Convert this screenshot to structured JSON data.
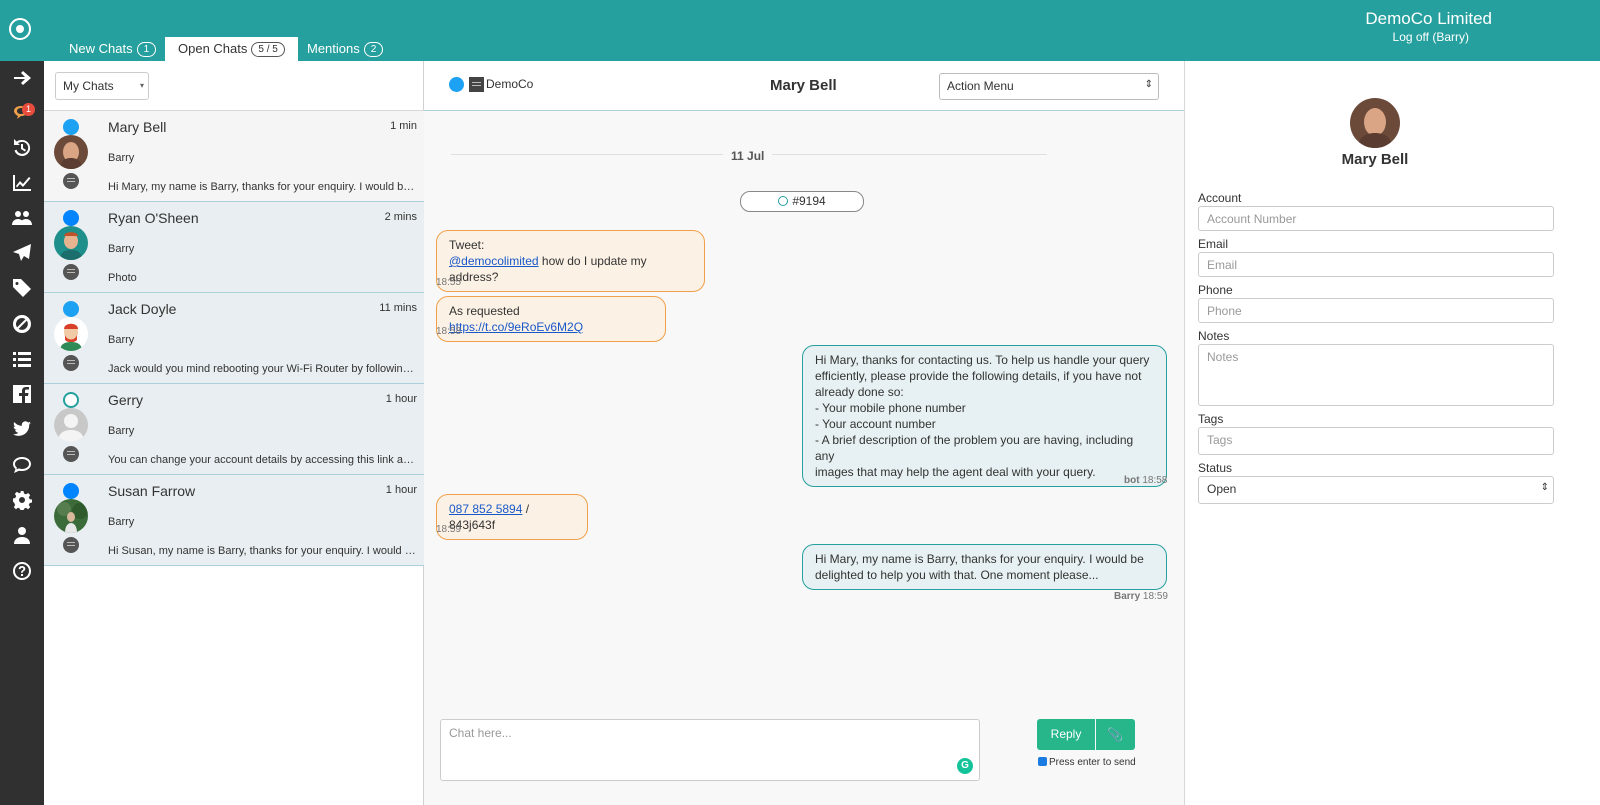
{
  "header": {
    "company": "DemoCo Limited",
    "logoff": "Log off (Barry)",
    "tabs": [
      {
        "label": "New Chats",
        "count": "1"
      },
      {
        "label": "Open Chats",
        "count": "5 / 5"
      },
      {
        "label": "Mentions",
        "count": "2"
      }
    ]
  },
  "nav": {
    "badge": "1",
    "items": [
      "arrow-right-icon",
      "chat-bubbles-icon",
      "history-icon",
      "chart-icon",
      "users-icon",
      "send-icon",
      "tag-icon",
      "block-icon",
      "list-icon",
      "facebook-icon",
      "twitter-icon",
      "comment-icon",
      "gear-icon",
      "user-icon",
      "help-icon"
    ]
  },
  "list": {
    "filter": "My Chats",
    "chats": [
      {
        "name": "Mary Bell",
        "time": "1 min",
        "agent": "Barry",
        "message": "Hi Mary, my name is Barry, thanks for your enquiry. I would be delighted to help you with that.",
        "channel": "twitter"
      },
      {
        "name": "Ryan O'Sheen",
        "time": "2 mins",
        "agent": "Barry",
        "message": "Photo",
        "channel": "messenger"
      },
      {
        "name": "Jack Doyle",
        "time": "11 mins",
        "agent": "Barry",
        "message": "Jack would you mind rebooting your Wi-Fi Router by following these steps",
        "channel": "twitter"
      },
      {
        "name": "Gerry",
        "time": "1 hour",
        "agent": "Barry",
        "message": "You can change your account details by accessing this link and logging in",
        "channel": "webchat"
      },
      {
        "name": "Susan Farrow",
        "time": "1 hour",
        "agent": "Barry",
        "message": "Hi Susan, my name is Barry, thanks for your enquiry. I would be delighted to help.",
        "channel": "messenger"
      }
    ]
  },
  "chat": {
    "company": "DemoCo",
    "customer": "Mary Bell",
    "action_menu": "Action Menu",
    "date": "11 Jul",
    "ticket": "#9194",
    "messages": [
      {
        "line1": "Tweet:",
        "link": "@democolimited",
        "text": " how do I update my address?",
        "time": "18:55"
      },
      {
        "prefix": "As requested ",
        "link": "https://t.co/9eRoEv6M2Q",
        "time": "18:58"
      },
      {
        "lines": [
          "Hi Mary, thanks for contacting us. To help us handle your query",
          "efficiently, please provide the following details, if you have not",
          "already done so:",
          "- Your mobile phone number",
          "- Your account number",
          "- A brief description of the problem you are having, including any",
          "images that may help the agent deal with your query."
        ],
        "sender": "bot",
        "time": "18:58"
      },
      {
        "link": "087 852 5894",
        "text": " / 843j643f",
        "time": "18:59"
      },
      {
        "lines": [
          "Hi Mary, my name is Barry, thanks for your enquiry. I would be",
          "delighted to help you with that. One moment please..."
        ],
        "sender": "Barry",
        "time": "18:59"
      }
    ],
    "input_placeholder": "Chat here...",
    "reply_label": "Reply",
    "press_enter": "Press enter to send"
  },
  "profile": {
    "name": "Mary Bell",
    "fields": [
      {
        "label": "Account",
        "placeholder": "Account Number"
      },
      {
        "label": "Email",
        "placeholder": "Email"
      },
      {
        "label": "Phone",
        "placeholder": "Phone"
      },
      {
        "label": "Notes",
        "placeholder": "Notes"
      },
      {
        "label": "Tags",
        "placeholder": "Tags"
      },
      {
        "label": "Status",
        "value": "Open"
      }
    ]
  },
  "colors": {
    "brand": "#26a09e",
    "nav_bg": "#303030",
    "incoming_border": "#f0a04b",
    "reply_button": "#26b68a"
  }
}
